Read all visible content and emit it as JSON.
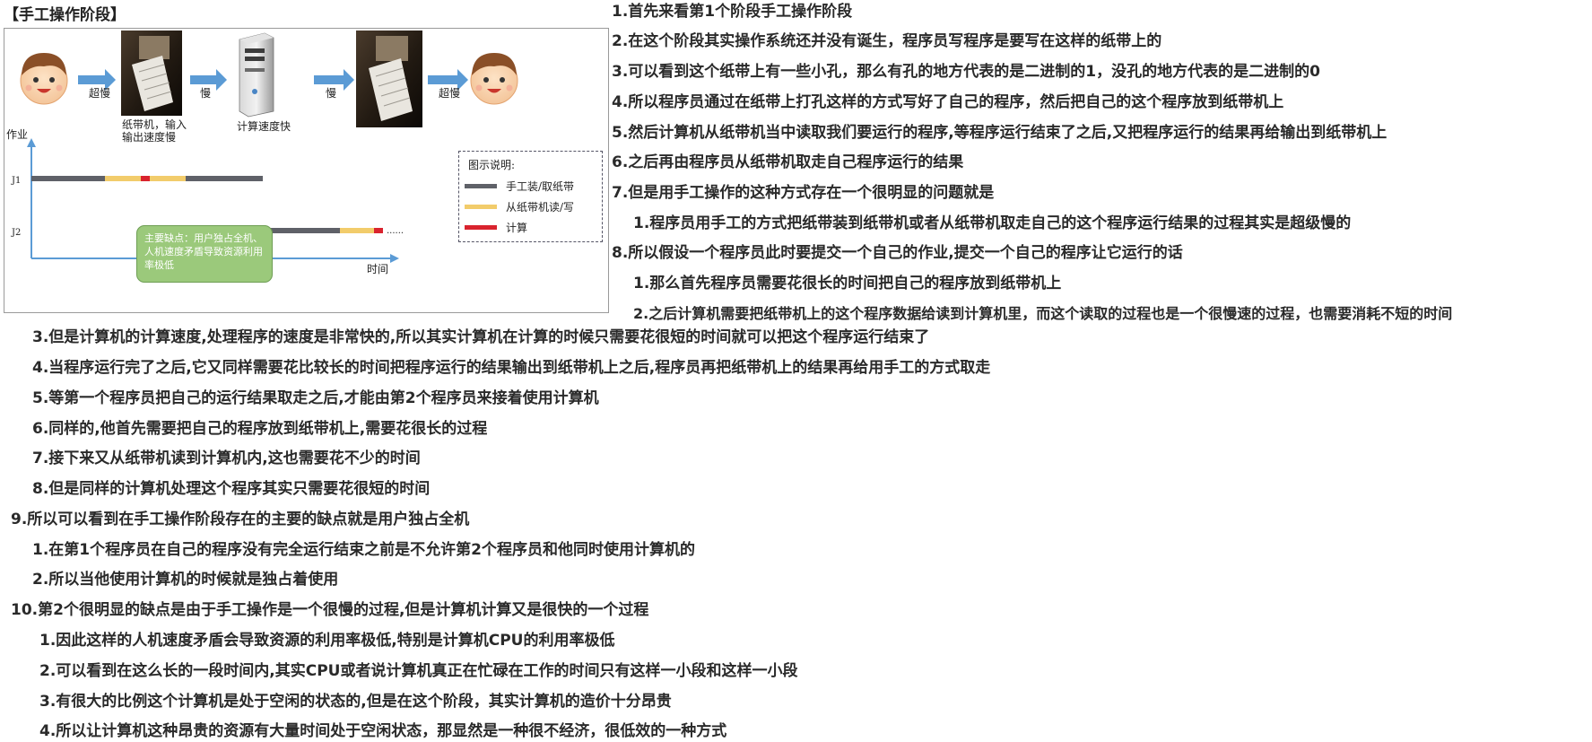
{
  "section_title": "【手工操作阶段】",
  "figure": {
    "labels": {
      "arrow1": "超慢",
      "arrow2": "慢",
      "arrow3": "慢",
      "arrow4": "超慢",
      "tape_caption_1": "纸带机，输入",
      "tape_caption_2": "输出速度慢",
      "computer_caption": "计算速度快",
      "y_axis": "作业",
      "x_axis": "时间",
      "job1": "J1",
      "job2": "J2",
      "ellipsis": "......"
    },
    "legend": {
      "title": "图示说明:",
      "items": [
        {
          "label": "手工装/取纸带",
          "color": "#5f6168"
        },
        {
          "label": "从纸带机读/写",
          "color": "#f2cc6b"
        },
        {
          "label": "计算",
          "color": "#d9232e"
        }
      ]
    },
    "callout": "主要缺点：用户独占全机、人机速度矛盾导致资源利用率极低",
    "colors": {
      "manual": "#5f6168",
      "io": "#f2cc6b",
      "compute": "#d9232e",
      "arrow": "#5b9bd5",
      "axis": "#5b9bd5",
      "callout": "#9bc97b"
    },
    "icons": [
      "programmer-face-icon",
      "paper-tape-photo",
      "computer-tower-icon"
    ]
  },
  "notes": [
    "1.首先来看第1个阶段手工操作阶段",
    "2.在这个阶段其实操作系统还并没有诞生，程序员写程序是要写在这样的纸带上的",
    "3.可以看到这个纸带上有一些小孔，那么有孔的地方代表的是二进制的1，没孔的地方代表的是二进制的0",
    "4.所以程序员通过在纸带上打孔这样的方式写好了自己的程序，然后把自己的这个程序放到纸带机上",
    "5.然后计算机从纸带机当中读取我们要运行的程序,等程序运行结束了之后,又把程序运行的结果再给输出到纸带机上",
    "6.之后再由程序员从纸带机取走自己程序运行的结果",
    "7.但是用手工操作的这种方式存在一个很明显的问题就是",
    "1.程序员用手工的方式把纸带装到纸带机或者从纸带机取走自己的这个程序运行结果的过程其实是超级慢的",
    "8.所以假设一个程序员此时要提交一个自己的作业,提交一个自己的程序让它运行的话",
    "1.那么首先程序员需要花很长的时间把自己的程序放到纸带机上",
    "2.之后计算机需要把纸带机上的这个程序数据给读到计算机里，而这个读取的过程也是一个很慢速的过程，也需要消耗不短的时间",
    "3.但是计算机的计算速度,处理程序的速度是非常快的,所以其实计算机在计算的时候只需要花很短的时间就可以把这个程序运行结束了",
    "4.当程序运行完了之后,它又同样需要花比较长的时间把程序运行的结果输出到纸带机上之后,程序员再把纸带机上的结果再给用手工的方式取走",
    "5.等第一个程序员把自己的运行结果取走之后,才能由第2个程序员来接着使用计算机",
    "6.同样的,他首先需要把自己的程序放到纸带机上,需要花很长的过程",
    "7.接下来又从纸带机读到计算机内,这也需要花不少的时间",
    "8.但是同样的计算机处理这个程序其实只需要花很短的时间",
    "9.所以可以看到在手工操作阶段存在的主要的缺点就是用户独占全机",
    "1.在第1个程序员在自己的程序没有完全运行结束之前是不允许第2个程序员和他同时使用计算机的",
    "2.所以当他使用计算机的时候就是独占着使用",
    "10.第2个很明显的缺点是由于手工操作是一个很慢的过程,但是计算机计算又是很快的一个过程",
    "1.因此这样的人机速度矛盾会导致资源的利用率极低,特别是计算机CPU的利用率极低",
    "2.可以看到在这么长的一段时间内,其实CPU或者说计算机真正在忙碌在工作的时间只有这样一小段和这样一小段",
    "3.有很大的比例这个计算机是处于空闲的状态的,但是在这个阶段，其实计算机的造价十分昂贵",
    "4.所以让计算机这种昂贵的资源有大量时间处于空闲状态，那显然是一种很不经济，很低效的一种方式"
  ]
}
